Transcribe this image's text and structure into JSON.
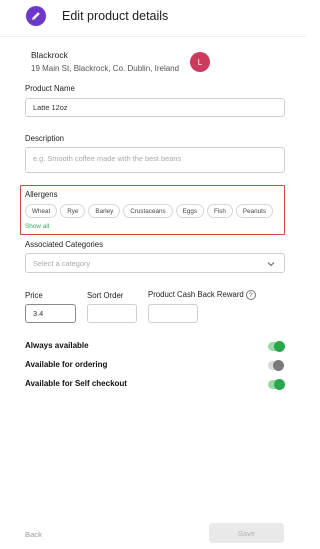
{
  "header": {
    "title": "Edit product details",
    "icon": "pencil-icon"
  },
  "store": {
    "name": "Blackrock",
    "address": "19 Main St, Blackrock, Co. Dublin, Ireland",
    "avatar_letter": "L"
  },
  "product_name": {
    "label": "Product Name",
    "value": "Latte 12oz"
  },
  "description": {
    "label": "Description",
    "placeholder": "e.g. Smooth coffee made with the best beans"
  },
  "allergens": {
    "label": "Allergens",
    "items": [
      "Wheat",
      "Rye",
      "Barley",
      "Crustaceans",
      "Eggs",
      "Fish",
      "Peanuts"
    ],
    "show_all": "Show all"
  },
  "categories": {
    "label": "Associated Categories",
    "placeholder": "Select a category"
  },
  "price": {
    "label": "Price",
    "value": "3.4"
  },
  "sort_order": {
    "label": "Sort Order",
    "value": ""
  },
  "cash_back": {
    "label": "Product Cash Back Reward",
    "value": ""
  },
  "toggles": [
    {
      "label": "Always available",
      "on": true
    },
    {
      "label": "Available for ordering",
      "on": false
    },
    {
      "label": "Available for Self checkout",
      "on": true
    }
  ],
  "footer": {
    "back": "Back",
    "save": "Save"
  },
  "colors": {
    "accent": "#6b38c9",
    "avatar": "#cc3b5d",
    "green": "#28a84a",
    "highlight": "#d8453a"
  }
}
